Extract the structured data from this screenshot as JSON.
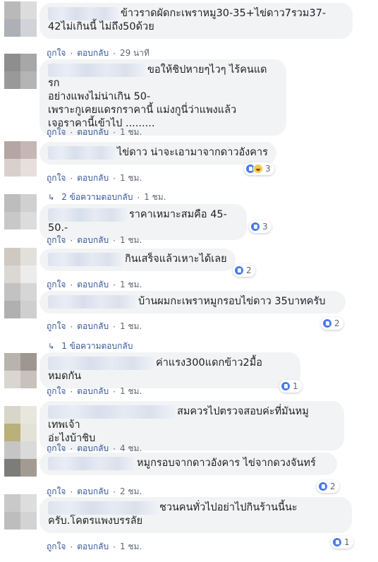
{
  "labels": {
    "like": "ถูกใจ",
    "reply": "ตอบกลับ",
    "sep": "·"
  },
  "comments": [
    {
      "text": "ข้าวราดผัดกะเพราหมู30-35+ไข่ดาว7รวม37-\n42ไม่เกินนี้ ไม่ถึง50ด้วย",
      "time": "29 นาที",
      "avatar": [
        "#b9b9b9",
        "#dcdcdc",
        "#aeb0b7",
        "#d2d3d8"
      ]
    },
    {
      "text": "ขอให้ชิปหายๆไวๆ ไร้คนแดรก\nอย่างแพงไม่น่าเกิน 50-\nเพราะกูเคยแดรกราคานี้ แม่งกูนี่ว่าแพงแล้ว\nเจอราคานี้เข้าไป .........",
      "time": "1 ชม.",
      "avatar": [
        "#8e8e8e",
        "#a7a7a7",
        "#999999",
        "#b4b4b4"
      ]
    },
    {
      "text": "ไข่ดาว น่าจะเอามาจากดาวอังคาร",
      "time": "1 ชม.",
      "reaction": "3",
      "haha": true,
      "avatar": [
        "#b6a6a3",
        "#c7b7b4",
        "#d9d0ce",
        "#e6dfde"
      ]
    },
    {
      "text": "ราคาเหมาะสมคือ 45-50.-",
      "time": "1 ชม.",
      "reaction": "3",
      "avatar": [
        "#bdbdbd",
        "#d0d0d0",
        "#c8c8c8",
        "#dcdcdc"
      ]
    },
    {
      "text": "กินเสร็จแล้วเหาะได้เลย",
      "time": "1 ชม.",
      "reaction": "2",
      "avatar": [
        "#cfc9c2",
        "#e3e0dc",
        "#dbd7d2",
        "#eeeceb"
      ]
    },
    {
      "text": "บ้านผมกะเพราหมูกรอบไข่ดาว 35บาทครับ",
      "time": "1 ชม.",
      "reaction": "2",
      "avatar": [
        "#c2c2c2",
        "#d6d6d6",
        "#b0b0b0",
        "#cfcfcf"
      ]
    },
    {
      "text": "ค่าแรง300แดกข้าว2มื้อหมดกัน",
      "time": "1 ชม.",
      "reaction": "1",
      "avatar": [
        "#b8b4ad",
        "#9d978f",
        "#d9d6d1",
        "#c7c2bb"
      ]
    },
    {
      "text": "สมควรไปตรวจสอบค่ะที่มันหมูเทพเจ้า\nอ่ะไงบ้าชิบ",
      "time": "4 ชม.",
      "avatar": [
        "#d8d6c8",
        "#e8e7de",
        "#b9b07a",
        "#e4e2d6"
      ]
    },
    {
      "text": "หมูกรอบจากดาวอังคาร ไข่จากดวงจันทร์",
      "time": "2 ชม.",
      "reaction": "2",
      "avatar": [
        "#c5c5c5",
        "#dadada",
        "#7c7c78",
        "#a29b92"
      ]
    },
    {
      "text": "ชวนคนทั่วไปอย่าไปกินร้านนี้นะ\nครับ.โคตรแพงบรรลัย",
      "time": "1 ชม.",
      "reaction": "1",
      "avatar": [
        "#c9c9c9",
        "#dddddd",
        "#bdbdbd",
        "#d3d3d3"
      ]
    }
  ],
  "reply_links": [
    {
      "text": "2 ข้อความตอบกลับ",
      "time": "1 ชม."
    },
    {
      "text": "1 ข้อความตอบกลับ"
    }
  ]
}
